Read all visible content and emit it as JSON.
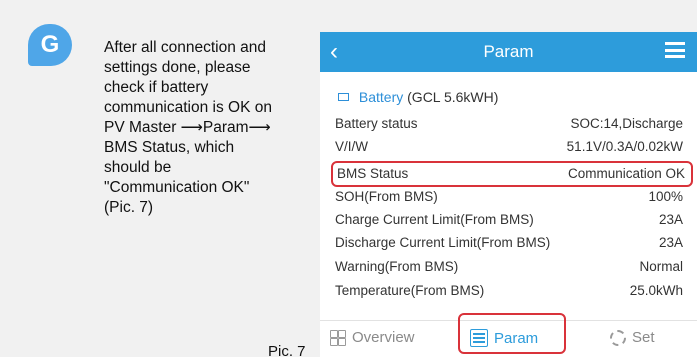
{
  "step_letter": "G",
  "instruction_lines": [
    "After all connection and",
    "settings done, please",
    "check if battery",
    "communication is OK on",
    "PV Master ⟶Param⟶",
    "BMS Status, which",
    "should be",
    "\"Communication OK\"",
    "(Pic. 7)"
  ],
  "pic_label": "Pic. 7",
  "app": {
    "title": "Param",
    "section": {
      "label": "Battery",
      "model": "(GCL 5.6kWH)"
    },
    "rows": [
      {
        "label": "Battery status",
        "value": "SOC:14,Discharge"
      },
      {
        "label": "V/I/W",
        "value": "51.1V/0.3A/0.02kW"
      },
      {
        "label": "BMS Status",
        "value": "Communication OK"
      },
      {
        "label": "SOH(From BMS)",
        "value": "100%"
      },
      {
        "label": "Charge Current Limit(From BMS)",
        "value": "23A"
      },
      {
        "label": "Discharge Current Limit(From BMS)",
        "value": "23A"
      },
      {
        "label": "Warning(From BMS)",
        "value": "Normal"
      },
      {
        "label": "Temperature(From BMS)",
        "value": "25.0kWh"
      }
    ],
    "nav": [
      {
        "label": "Overview",
        "icon": "grid-icon"
      },
      {
        "label": "Param",
        "icon": "sliders-icon",
        "active": true
      },
      {
        "label": "Set",
        "icon": "gear-icon"
      }
    ]
  },
  "colors": {
    "accent": "#2d9cdb",
    "highlight": "#d9323a",
    "badge": "#4fa6e8"
  }
}
